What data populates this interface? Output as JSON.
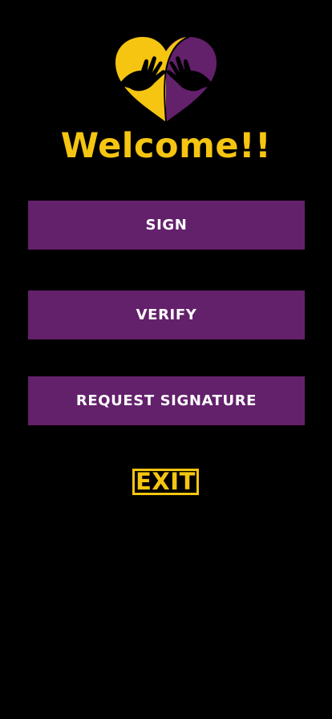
{
  "welcome": {
    "title": "Welcome!!"
  },
  "logo": {
    "icon": "heart-hands-icon",
    "colors": {
      "left": "#f5c511",
      "right": "#63206b",
      "outline": "#000000"
    }
  },
  "buttons": {
    "sign": "SIGN",
    "verify": "VERIFY",
    "request": "REQUEST SIGNATURE"
  },
  "exit": {
    "label": "EXIT"
  },
  "colors": {
    "background": "#000000",
    "accent": "#f5c511",
    "button": "#63206b",
    "button_text": "#ffffff"
  }
}
